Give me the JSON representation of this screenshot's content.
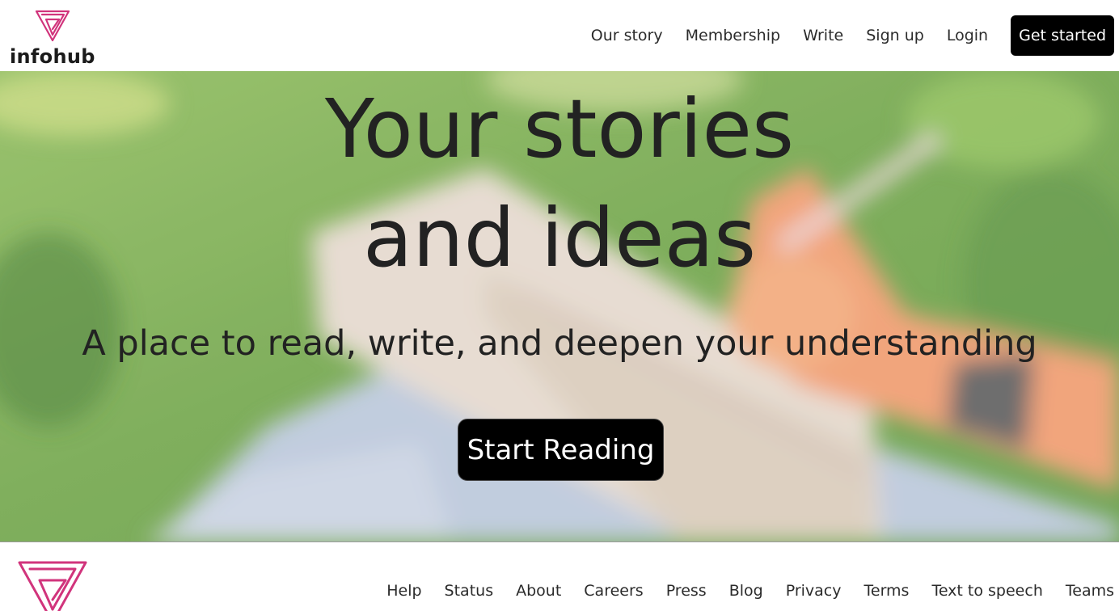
{
  "brand": {
    "name": "infohub",
    "logo_icon": "triangle-spiral-logo",
    "accent_color": "#d1347c"
  },
  "header": {
    "nav": [
      {
        "label": "Our story"
      },
      {
        "label": "Membership"
      },
      {
        "label": "Write"
      },
      {
        "label": "Sign up"
      },
      {
        "label": "Login"
      }
    ],
    "cta_label": "Get started"
  },
  "hero": {
    "title_line1": "Your stories",
    "title_line2": "and ideas",
    "subtitle": "A place to read, write, and deepen your understanding",
    "button_label": "Start Reading",
    "background": "blurred photo of a hand writing in a notebook on grass"
  },
  "footer": {
    "links": [
      {
        "label": "Help"
      },
      {
        "label": "Status"
      },
      {
        "label": "About"
      },
      {
        "label": "Careers"
      },
      {
        "label": "Press"
      },
      {
        "label": "Blog"
      },
      {
        "label": "Privacy"
      },
      {
        "label": "Terms"
      },
      {
        "label": "Text to speech"
      },
      {
        "label": "Teams"
      }
    ]
  }
}
